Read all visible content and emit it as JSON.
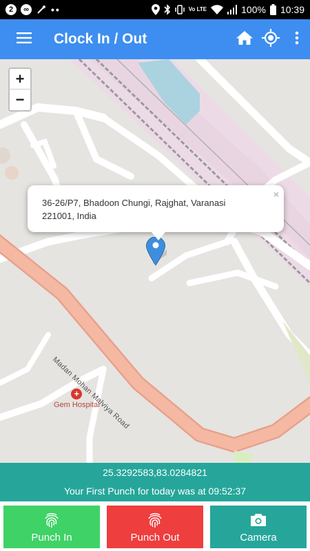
{
  "status_bar": {
    "left_badges": [
      "2",
      "∞"
    ],
    "dots": "••",
    "lte_label": "Vo LTE",
    "battery": "100%",
    "time": "10:39"
  },
  "app_bar": {
    "title": "Clock In / Out",
    "icons": [
      "menu-icon",
      "home-icon",
      "location-target-icon",
      "more-vert-icon"
    ]
  },
  "map": {
    "zoom_in": "+",
    "zoom_out": "−",
    "popup": {
      "address": "36-26/P7, Bhadoon Chungi, Rajghat, Varanasi 221001, India",
      "close": "×"
    },
    "road_label": "Madan Mohan Malviya Road",
    "poi": {
      "label": "Gem Hospital",
      "icon": "+"
    }
  },
  "info": {
    "coordinates": "25.3292583,83.0284821",
    "first_punch": "Your First Punch for today was at 09:52:37"
  },
  "buttons": {
    "punch_in": "Punch In",
    "punch_out": "Punch Out",
    "camera": "Camera"
  },
  "colors": {
    "app_bar": "#3d8ef0",
    "info_panel": "#26a69a",
    "punch_in": "#3fd267",
    "punch_out": "#ef3e3e",
    "camera": "#26a69a"
  }
}
